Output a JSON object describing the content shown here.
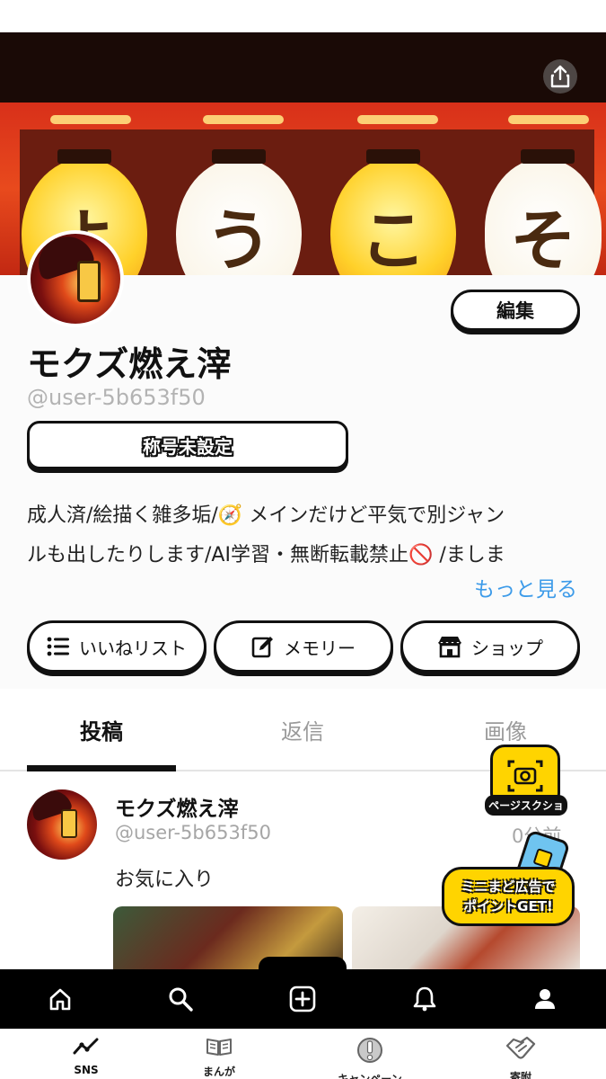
{
  "banner": {
    "lantern_chars": [
      "よ",
      "う",
      "こ",
      "そ"
    ]
  },
  "profile": {
    "display_name": "モクズ燃え滓",
    "handle": "@user-5b653f50",
    "edit_label": "編集",
    "title_label": "称号未設定",
    "bio_lines": [
      "成人済/絵描く雑多垢/🧭 メインだけど平気で別ジャン",
      "ルも出したりします/AI学習・無断転載禁止🚫 /ましま"
    ],
    "more_label": "もっと見る"
  },
  "actions": [
    {
      "label": "いいねリスト",
      "icon": "list-icon"
    },
    {
      "label": "メモリー",
      "icon": "edit-note-icon"
    },
    {
      "label": "ショップ",
      "icon": "shop-icon"
    }
  ],
  "tabs": [
    {
      "label": "投稿",
      "active": true
    },
    {
      "label": "返信",
      "active": false
    },
    {
      "label": "画像",
      "active": false
    }
  ],
  "post": {
    "name": "モクズ燃え滓",
    "handle": "@user-5b653f50",
    "time": "0分前",
    "text": "お気に入り"
  },
  "floating": {
    "screenshot_label": "ページスクショ",
    "ad_line1": "ミニまど広告で",
    "ad_line2": "ポイントGET!"
  },
  "bottom_toolbar": [
    "home-icon",
    "search-icon",
    "plus-square-icon",
    "bell-icon",
    "user-icon"
  ],
  "app_tabs": [
    {
      "label": "SNS",
      "icon": "trend-icon",
      "active": true
    },
    {
      "label": "まんが",
      "icon": "book-icon",
      "active": false
    },
    {
      "label": "キャンペーン",
      "icon": "exclamation-icon",
      "active": false
    },
    {
      "label": "寄附",
      "icon": "heart-hands-icon",
      "active": false
    }
  ],
  "colors": {
    "accent_link": "#3d9be9",
    "button_border": "#111111",
    "float_yellow": "#ffd400",
    "toolbar_bg": "#000000"
  }
}
